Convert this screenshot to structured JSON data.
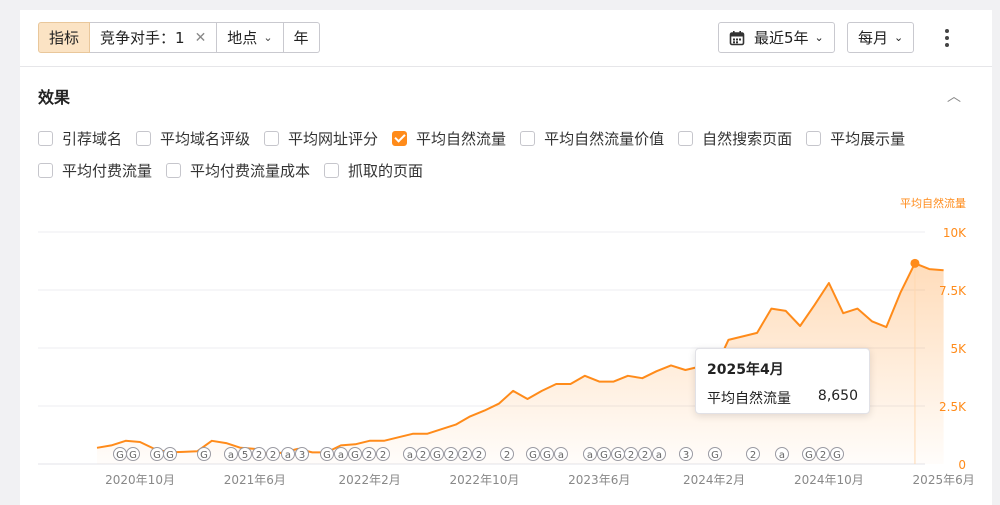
{
  "toolbar": {
    "metrics_tab": "指标",
    "competitors": "竞争对手：1",
    "location": "地点",
    "year": "年",
    "range": "最近5年",
    "interval": "每月"
  },
  "section": {
    "title": "效果"
  },
  "metrics": [
    {
      "label": "引荐域名",
      "checked": false
    },
    {
      "label": "平均域名评级",
      "checked": false
    },
    {
      "label": "平均网址评分",
      "checked": false
    },
    {
      "label": "平均自然流量",
      "checked": true
    },
    {
      "label": "平均自然流量价值",
      "checked": false
    },
    {
      "label": "自然搜索页面",
      "checked": false
    },
    {
      "label": "平均展示量",
      "checked": false
    },
    {
      "label": "平均付费流量",
      "checked": false
    },
    {
      "label": "平均付费流量成本",
      "checked": false
    },
    {
      "label": "抓取的页面",
      "checked": false
    }
  ],
  "chart_data": {
    "type": "area",
    "ylabel": "平均自然流量",
    "ylim": [
      0,
      10000
    ],
    "y_ticks": [
      "0",
      "2.5K",
      "5K",
      "7.5K",
      "10K"
    ],
    "x_ticks": [
      "2020年10月",
      "2021年6月",
      "2022年2月",
      "2022年10月",
      "2023年6月",
      "2024年2月",
      "2024年10月",
      "2025年6月"
    ],
    "series": [
      {
        "name": "平均自然流量",
        "color": "#ff8b1a",
        "x": [
          "2020-07",
          "2020-08",
          "2020-09",
          "2020-10",
          "2020-11",
          "2020-12",
          "2021-01",
          "2021-02",
          "2021-03",
          "2021-04",
          "2021-05",
          "2021-06",
          "2021-07",
          "2021-08",
          "2021-09",
          "2021-10",
          "2021-11",
          "2021-12",
          "2022-01",
          "2022-02",
          "2022-03",
          "2022-04",
          "2022-05",
          "2022-06",
          "2022-07",
          "2022-08",
          "2022-09",
          "2022-10",
          "2022-11",
          "2022-12",
          "2023-01",
          "2023-02",
          "2023-03",
          "2023-04",
          "2023-05",
          "2023-06",
          "2023-07",
          "2023-08",
          "2023-09",
          "2023-10",
          "2023-11",
          "2023-12",
          "2024-01",
          "2024-02",
          "2024-03",
          "2024-04",
          "2024-05",
          "2024-06",
          "2024-07",
          "2024-08",
          "2024-09",
          "2024-10",
          "2024-11",
          "2024-12",
          "2025-01",
          "2025-02",
          "2025-03",
          "2025-04",
          "2025-05",
          "2025-06"
        ],
        "values": [
          700,
          800,
          1000,
          950,
          650,
          500,
          520,
          550,
          1000,
          900,
          700,
          650,
          400,
          500,
          650,
          500,
          500,
          800,
          850,
          1000,
          1000,
          1150,
          1300,
          1300,
          1500,
          1700,
          2050,
          2300,
          2600,
          3150,
          2800,
          3150,
          3450,
          3450,
          3800,
          3550,
          3550,
          3800,
          3700,
          4000,
          4250,
          4050,
          4200,
          4000,
          5350,
          5500,
          5650,
          6700,
          6600,
          5950,
          6850,
          7800,
          6500,
          6700,
          6150,
          5900,
          7400,
          8650,
          8400,
          8350
        ]
      }
    ],
    "highlight": {
      "index": 57,
      "label": "2025年4月",
      "series": "平均自然流量",
      "value": "8,650"
    },
    "annotations": [
      "G",
      "G",
      "G",
      "G",
      "G",
      "a",
      "5",
      "2",
      "2",
      "a",
      "3",
      "G",
      "a",
      "G",
      "2",
      "2",
      "a",
      "2",
      "G",
      "2",
      "2",
      "2",
      "2",
      "G",
      "G",
      "a",
      "a",
      "G",
      "G",
      "2",
      "2",
      "a",
      "3",
      "G",
      "2",
      "a",
      "G",
      "2",
      "G"
    ]
  }
}
